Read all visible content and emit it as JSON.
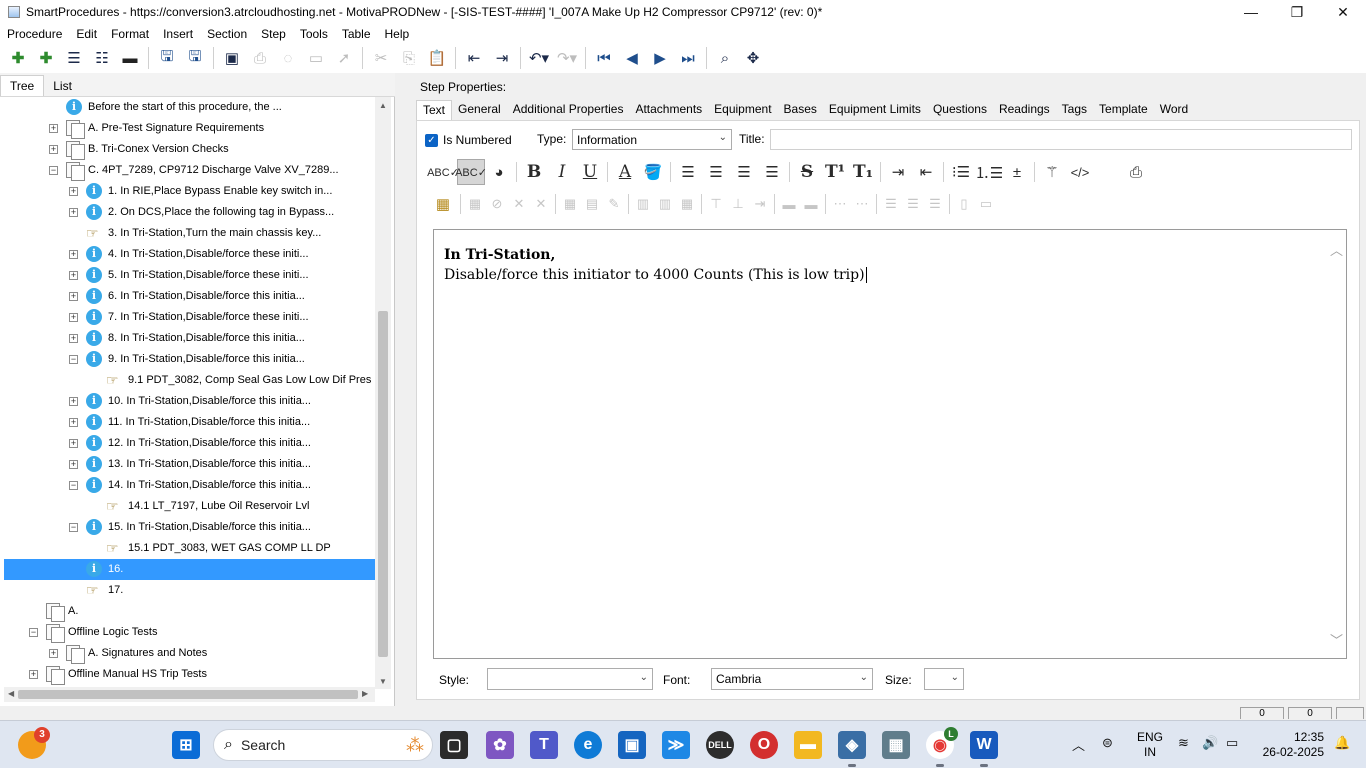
{
  "window": {
    "title": "SmartProcedures - https://conversion3.atrcloudhosting.net - MotivaPRODNew - [-SIS-TEST-####] 'I_007A Make Up H2 Compressor CP9712' (rev: 0)*",
    "minimize": "—",
    "maximize": "❐",
    "close": "✕"
  },
  "menu": [
    "Procedure",
    "Edit",
    "Format",
    "Insert",
    "Section",
    "Step",
    "Tools",
    "Table",
    "Help"
  ],
  "tree": {
    "tabs": [
      "Tree",
      "List"
    ],
    "rows": [
      {
        "label": "Before the start of this procedure, the ...",
        "icon": "info-icon",
        "expander": ""
      },
      {
        "label": "A. Pre-Test Signature Requirements",
        "icon": "section-doc-icon",
        "expander": "+"
      },
      {
        "label": "B. Tri-Conex Version Checks",
        "icon": "section-doc-icon",
        "expander": "+"
      },
      {
        "label": "C. 4PT_7289, CP9712 Discharge Valve XV_7289...",
        "icon": "section-doc-icon",
        "expander": "−"
      },
      {
        "label": "1. In RIE,Place Bypass Enable key switch in...",
        "icon": "info-icon",
        "expander": "+"
      },
      {
        "label": "2. On DCS,Place the following tag in Bypass...",
        "icon": "info-icon",
        "expander": "+"
      },
      {
        "label": "3. In Tri-Station,Turn the main chassis key...",
        "icon": "hand-pointer-icon",
        "expander": ""
      },
      {
        "label": "4. In Tri-Station,Disable/force these initi...",
        "icon": "info-icon",
        "expander": "+"
      },
      {
        "label": "5. In Tri-Station,Disable/force these initi...",
        "icon": "info-icon",
        "expander": "+"
      },
      {
        "label": "6. In Tri-Station,Disable/force this initia...",
        "icon": "info-icon",
        "expander": "+"
      },
      {
        "label": "7. In Tri-Station,Disable/force these initi...",
        "icon": "info-icon",
        "expander": "+"
      },
      {
        "label": "8. In Tri-Station,Disable/force this initia...",
        "icon": "info-icon",
        "expander": "+"
      },
      {
        "label": "9. In Tri-Station,Disable/force this initia...",
        "icon": "info-icon",
        "expander": "−"
      },
      {
        "label": "9.1 PDT_3082, Comp Seal Gas Low Low Dif Pres",
        "icon": "hand-pointer-icon",
        "expander": ""
      },
      {
        "label": "10. In Tri-Station,Disable/force this initia...",
        "icon": "info-icon",
        "expander": "+"
      },
      {
        "label": "11. In Tri-Station,Disable/force this initia...",
        "icon": "info-icon",
        "expander": "+"
      },
      {
        "label": "12. In Tri-Station,Disable/force this initia...",
        "icon": "info-icon",
        "expander": "+"
      },
      {
        "label": "13. In Tri-Station,Disable/force this initia...",
        "icon": "info-icon",
        "expander": "+"
      },
      {
        "label": "14. In Tri-Station,Disable/force this initia...",
        "icon": "info-icon",
        "expander": "−"
      },
      {
        "label": "14.1 LT_7197, Lube Oil Reservoir Lvl",
        "icon": "hand-pointer-icon",
        "expander": ""
      },
      {
        "label": "15. In Tri-Station,Disable/force this initia...",
        "icon": "info-icon",
        "expander": "−"
      },
      {
        "label": "15.1 PDT_3083, WET GAS COMP LL DP",
        "icon": "hand-pointer-icon",
        "expander": ""
      },
      {
        "label": "16.",
        "icon": "info-icon",
        "expander": "",
        "selected": true
      },
      {
        "label": "17.",
        "icon": "hand-pointer-icon",
        "expander": ""
      },
      {
        "label": "A.",
        "icon": "procedure-doc-icon",
        "expander": ""
      },
      {
        "label": "Offline Logic Tests",
        "icon": "procedure-doc-icon",
        "expander": "−"
      },
      {
        "label": "A. Signatures and Notes",
        "icon": "section-doc-icon",
        "expander": "+"
      },
      {
        "label": "Offline Manual HS Trip Tests",
        "icon": "procedure-doc-icon",
        "expander": "+"
      }
    ]
  },
  "step": {
    "heading": "Step Properties:",
    "tabs": [
      "Text",
      "General",
      "Additional Properties",
      "Attachments",
      "Equipment",
      "Bases",
      "Equipment Limits",
      "Questions",
      "Readings",
      "Tags",
      "Template",
      "Word"
    ],
    "is_numbered_label": "Is Numbered",
    "is_numbered": true,
    "type_label": "Type:",
    "type_value": "Information",
    "title_label": "Title:",
    "title_value": "",
    "editor_line1": "In Tri-Station,",
    "editor_line2": "Disable/force this initiator to 4000 Counts (This is low trip)",
    "style_label": "Style:",
    "style_value": "",
    "font_label": "Font:",
    "font_value": "Cambria",
    "size_label": "Size:",
    "size_value": ""
  },
  "status": {
    "box1": "0",
    "box2": "0"
  },
  "taskbar": {
    "search_placeholder": "Search",
    "notification_count": "3",
    "language_top": "ENG",
    "language_bottom": "IN",
    "time": "12:35",
    "date": "26-02-2025",
    "chrome_badge": "L"
  },
  "colors": {
    "selection": "#3399ff",
    "info_icon": "#39a9e8",
    "accent": "#0b63c5"
  }
}
